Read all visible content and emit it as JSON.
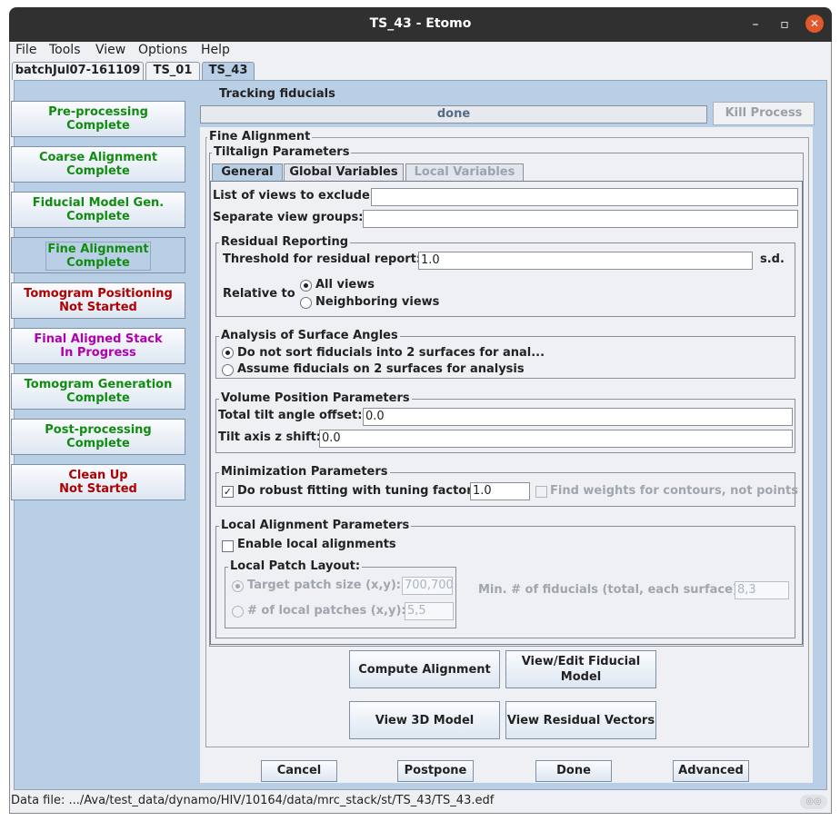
{
  "window": {
    "title": "TS_43 - Etomo"
  },
  "menu": [
    "File",
    "Tools",
    "View",
    "Options",
    "Help"
  ],
  "top_tabs": [
    "batchJul07-161109",
    "TS_01",
    "TS_43"
  ],
  "nav": [
    {
      "line1": "Pre-processing",
      "line2": "Complete",
      "state": "complete"
    },
    {
      "line1": "Coarse Alignment",
      "line2": "Complete",
      "state": "complete"
    },
    {
      "line1": "Fiducial Model Gen.",
      "line2": "Complete",
      "state": "complete"
    },
    {
      "line1": "Fine Alignment",
      "line2": "Complete",
      "state": "complete"
    },
    {
      "line1": "Tomogram Positioning",
      "line2": "Not Started",
      "state": "not-started"
    },
    {
      "line1": "Final Aligned Stack",
      "line2": "In Progress",
      "state": "in-progress"
    },
    {
      "line1": "Tomogram Generation",
      "line2": "Complete",
      "state": "complete"
    },
    {
      "line1": "Post-processing",
      "line2": "Complete",
      "state": "complete"
    },
    {
      "line1": "Clean Up",
      "line2": "Not Started",
      "state": "not-started"
    }
  ],
  "process": {
    "label": "Tracking fiducials",
    "status": "done",
    "kill": "Kill Process"
  },
  "fine_alignment": {
    "title": "Fine Alignment",
    "tiltalign_title": "Tiltalign Parameters",
    "tabs": [
      "General",
      "Global Variables",
      "Local Variables"
    ],
    "exclude_label": "List of views to exclude:",
    "exclude_value": "",
    "groups_label": "Separate view groups:",
    "groups_value": "",
    "residual": {
      "title": "Residual Reporting",
      "threshold_label": "Threshold for residual report:",
      "threshold_value": "1.0",
      "unit": "s.d.",
      "relative_label": "Relative to",
      "opt_all": "All views",
      "opt_neighbor": "Neighboring views"
    },
    "surface": {
      "title": "Analysis of Surface Angles",
      "opt1": "Do not sort fiducials into 2 surfaces for anal...",
      "opt2": "Assume fiducials on 2 surfaces for analysis"
    },
    "volume": {
      "title": "Volume Position Parameters",
      "offset_label": "Total tilt angle offset:",
      "offset_value": "0.0",
      "zshift_label": "Tilt axis z shift:",
      "zshift_value": "0.0"
    },
    "minimization": {
      "title": "Minimization Parameters",
      "robust_label": "Do robust fitting with tuning factor:",
      "robust_value": "1.0",
      "weights_label": "Find weights for contours, not points"
    },
    "local": {
      "title": "Local Alignment Parameters",
      "enable_label": "Enable local alignments",
      "patch_title": "Local Patch Layout:",
      "target_label": "Target patch size (x,y):",
      "target_value": "700,700",
      "num_label": "# of local patches (x,y):",
      "num_value": "5,5",
      "min_label": "Min. # of fiducials (total, each surface):",
      "min_value": "8,3"
    }
  },
  "actions": {
    "compute": "Compute Alignment",
    "view_edit_line1": "View/Edit Fiducial",
    "view_edit_line2": "Model",
    "view3d": "View 3D Model",
    "residual": "View Residual Vectors"
  },
  "bottom": {
    "cancel": "Cancel",
    "postpone": "Postpone",
    "done": "Done",
    "advanced": "Advanced"
  },
  "status_bar": "Data file: .../Ava/test_data/dynamo/HIV/10164/data/mrc_stack/st/TS_43/TS_43.edf"
}
